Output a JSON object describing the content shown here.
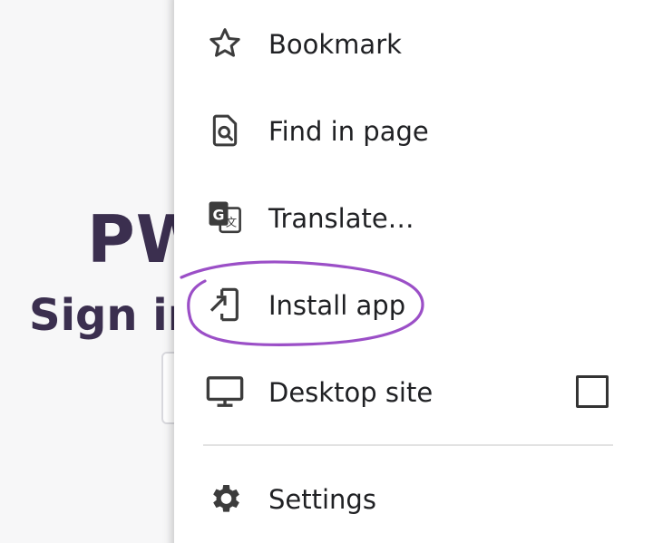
{
  "background_page": {
    "title_fragment": "PW",
    "subtitle_fragment": "Sign in"
  },
  "menu": {
    "items": [
      {
        "label": "Bookmark",
        "icon": "star-outline-icon"
      },
      {
        "label": "Find in page",
        "icon": "find-in-page-icon"
      },
      {
        "label": "Translate…",
        "icon": "translate-icon"
      },
      {
        "label": "Install app",
        "icon": "install-app-icon"
      },
      {
        "label": "Desktop site",
        "icon": "desktop-icon",
        "checked": false
      },
      {
        "label": "Settings",
        "icon": "gear-icon"
      }
    ]
  },
  "annotation": {
    "color": "#9b4fc7",
    "highlighted_item": "Install app"
  },
  "colors": {
    "menu_text": "#202124",
    "icon": "#3c3c3c",
    "background_heading": "#3b2f4f"
  }
}
